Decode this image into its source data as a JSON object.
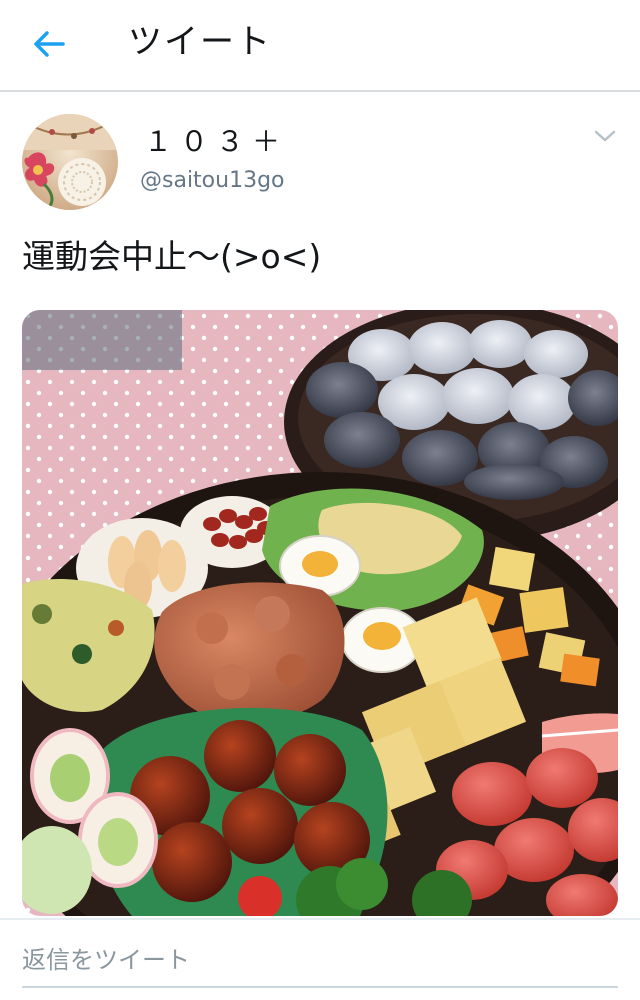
{
  "header": {
    "back_icon": "arrow-left-icon",
    "title": "ツイート",
    "accent_color": "#1da1f2"
  },
  "tweet": {
    "author": {
      "display_name": "１０３＋",
      "handle": "@saitou13go",
      "avatar_icon": "avatar-lace-doily-image"
    },
    "menu_icon": "chevron-down-icon",
    "text": "運動会中止〜(>o<)",
    "media": {
      "kind": "photo",
      "subject": "bento-food-photo"
    }
  },
  "reply": {
    "placeholder": "返信をツイート"
  }
}
